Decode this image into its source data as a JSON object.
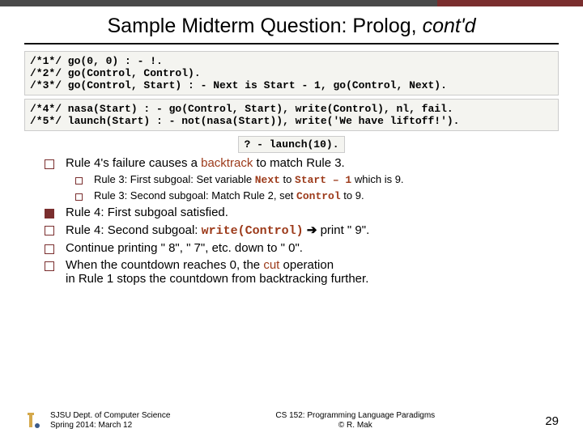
{
  "title": {
    "main": "Sample Midterm Question: Prolog, ",
    "cont": "cont'd"
  },
  "code1": "/*1*/ go(0, 0) : - !.\n/*2*/ go(Control, Control).\n/*3*/ go(Control, Start) : - Next is Start - 1, go(Control, Next).",
  "code2": "/*4*/ nasa(Start) : - go(Control, Start), write(Control), nl, fail.\n/*5*/ launch(Start) : - not(nasa(Start)), write('We have liftoff!').",
  "query": "? - launch(10).",
  "b1": {
    "pre": "Rule 4's failure causes a ",
    "em": "backtrack",
    "post": " to match Rule 3."
  },
  "s1": {
    "pre": "Rule 3: First subgoal: Set variable ",
    "c1": "Next",
    "mid1": " to ",
    "c2": "Start – 1",
    "post": " which is 9."
  },
  "s2": {
    "pre": "Rule 3: Second subgoal: Match Rule 2, set ",
    "c1": "Control",
    "post": " to 9."
  },
  "b2": "Rule 4: First subgoal satisfied.",
  "b3": {
    "pre": "Rule 4: Second subgoal: ",
    "c1": "write(Control)",
    "arrow": " ➔ ",
    "post": "print \" 9\"."
  },
  "b4": "Continue printing \" 8\", \" 7\", etc. down to \" 0\".",
  "b5": {
    "l1pre": "When the countdown reaches 0, the ",
    "l1em": "cut",
    "l1post": " operation",
    "l2": "in Rule 1 stops the countdown from backtracking further."
  },
  "footer": {
    "left1": "SJSU Dept. of Computer Science",
    "left2": "Spring 2014: March 12",
    "mid1": "CS 152: Programming Language Paradigms",
    "mid2": "© R. Mak",
    "page": "29"
  }
}
